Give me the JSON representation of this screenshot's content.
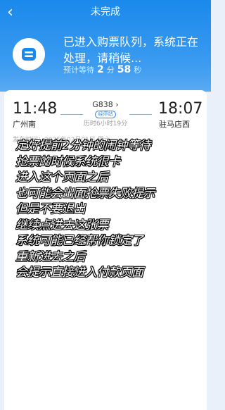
{
  "nav": {
    "title": "未完成",
    "back_icon": "back-arrow-icon"
  },
  "status": {
    "icon": "queue-ticket-icon",
    "message": "已进入购票队列，系统正在处理，请稍候...",
    "wait_prefix": "预计等待",
    "wait_minutes": "2",
    "minutes_unit": "分",
    "wait_seconds": "58",
    "seconds_unit": "秒"
  },
  "trip": {
    "depart_time": "11:48",
    "depart_station": "广州南",
    "train_no": "G838",
    "train_tag": "经停站",
    "duration": "历时6小时19分",
    "arrive_time": "18:07",
    "arrive_station": "驻马店西",
    "depart_date": "发车时间：2025年02月01日 周六"
  },
  "subtitles": [
    "定好提前2分钟的闹钟等待",
    "抢票的时候系统很卡",
    "进入这个页面之后",
    "也可能会出面抢票失败提示",
    "但是不要退出",
    "继续点进去这张票",
    "系统可能已经帮你锁定了",
    "重新进去之后",
    "会提示直接进入付款页面"
  ]
}
